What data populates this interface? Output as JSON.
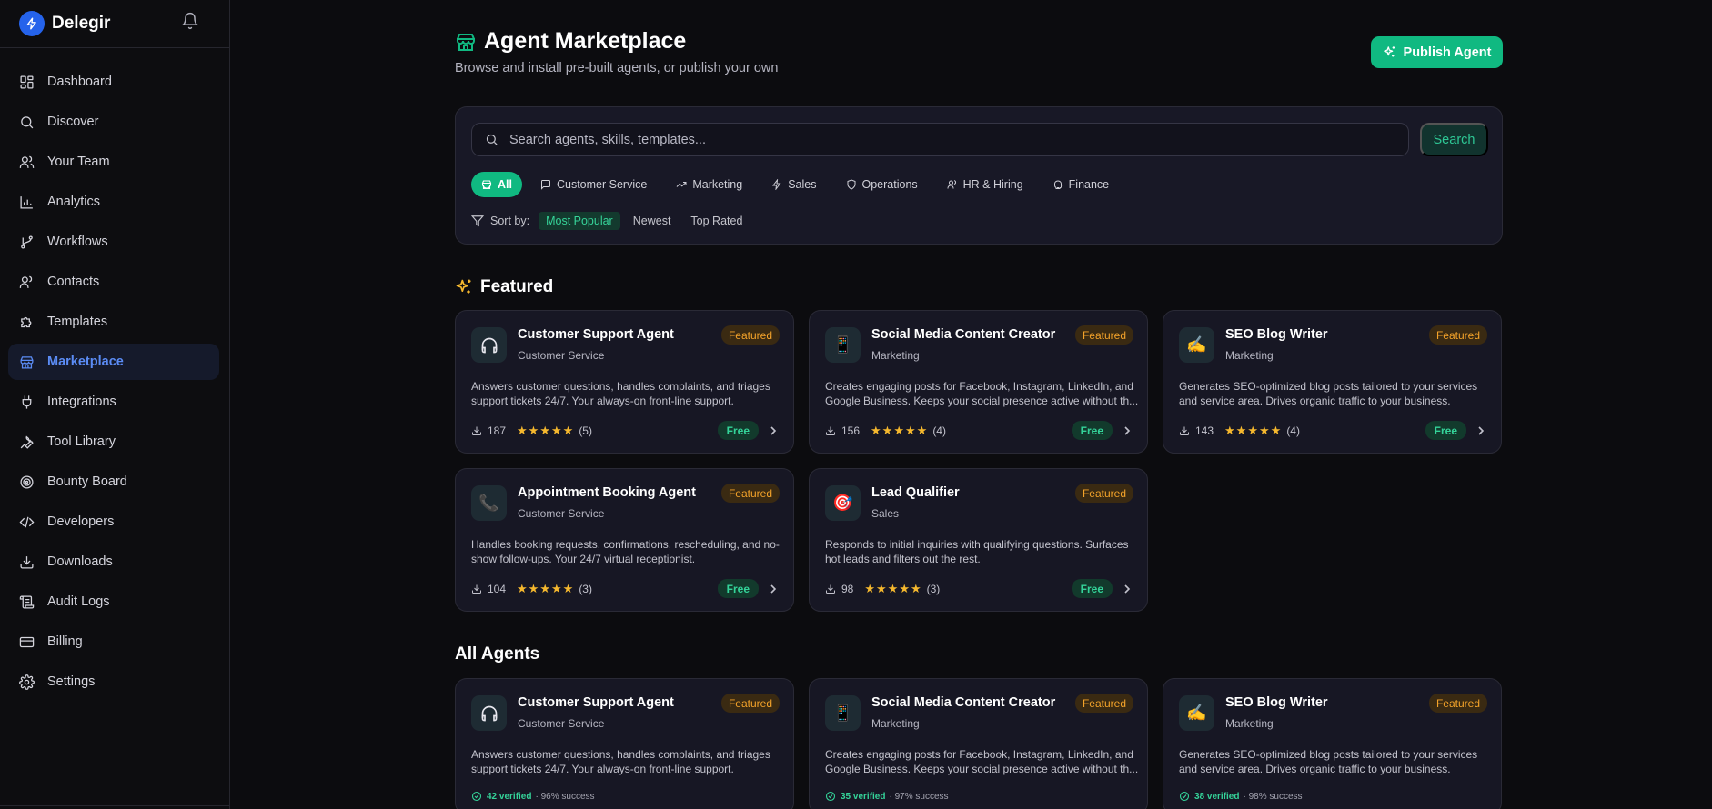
{
  "brand": {
    "name": "Delegir",
    "color": "#2563eb",
    "logo_icon": "bolt-icon"
  },
  "sidebar": {
    "items": [
      {
        "label": "Dashboard",
        "icon": "dashboard-icon"
      },
      {
        "label": "Discover",
        "icon": "search-icon"
      },
      {
        "label": "Your Team",
        "icon": "team-icon"
      },
      {
        "label": "Analytics",
        "icon": "analytics-icon"
      },
      {
        "label": "Workflows",
        "icon": "workflow-icon"
      },
      {
        "label": "Contacts",
        "icon": "contacts-icon"
      },
      {
        "label": "Templates",
        "icon": "puzzle-icon"
      },
      {
        "label": "Marketplace",
        "icon": "store-icon",
        "active": true
      },
      {
        "label": "Integrations",
        "icon": "plug-icon"
      },
      {
        "label": "Tool Library",
        "icon": "wrench-icon"
      },
      {
        "label": "Bounty Board",
        "icon": "target-icon"
      },
      {
        "label": "Developers",
        "icon": "code-icon"
      },
      {
        "label": "Downloads",
        "icon": "download-icon"
      },
      {
        "label": "Audit Logs",
        "icon": "scroll-icon"
      },
      {
        "label": "Billing",
        "icon": "card-icon"
      },
      {
        "label": "Settings",
        "icon": "gear-icon"
      }
    ]
  },
  "header": {
    "title": "Agent Marketplace",
    "subtitle": "Browse and install pre-built agents, or publish your own",
    "publish_label": "Publish Agent"
  },
  "search": {
    "placeholder": "Search agents, skills, templates...",
    "value": "",
    "button_label": "Search"
  },
  "categories": [
    {
      "label": "All",
      "active": true
    },
    {
      "label": "Customer Service"
    },
    {
      "label": "Marketing"
    },
    {
      "label": "Sales"
    },
    {
      "label": "Operations"
    },
    {
      "label": "HR & Hiring"
    },
    {
      "label": "Finance"
    }
  ],
  "sort": {
    "label": "Sort by:",
    "options": [
      "Most Popular",
      "Newest",
      "Top Rated"
    ],
    "selected": "Most Popular"
  },
  "featured": {
    "title": "Featured",
    "cards": [
      {
        "name": "Customer Support Agent",
        "category": "Customer Service",
        "badge": "Featured",
        "emoji": "🎧",
        "description": "Answers customer questions, handles complaints, and triages support tickets 24/7. Your always-on front-line support.",
        "downloads": "187",
        "stars": "★★★★★",
        "rating_count": "(5)",
        "price": "Free"
      },
      {
        "name": "Social Media Content Creator",
        "category": "Marketing",
        "badge": "Featured",
        "emoji": "📱",
        "description": "Creates engaging posts for Facebook, Instagram, LinkedIn, and Google Business. Keeps your social presence active without th...",
        "downloads": "156",
        "stars": "★★★★★",
        "rating_count": "(4)",
        "price": "Free"
      },
      {
        "name": "SEO Blog Writer",
        "category": "Marketing",
        "badge": "Featured",
        "emoji": "✍️",
        "description": "Generates SEO-optimized blog posts tailored to your services and service area. Drives organic traffic to your business.",
        "downloads": "143",
        "stars": "★★★★★",
        "rating_count": "(4)",
        "price": "Free"
      },
      {
        "name": "Appointment Booking Agent",
        "category": "Customer Service",
        "badge": "Featured",
        "emoji": "📞",
        "description": "Handles booking requests, confirmations, rescheduling, and no-show follow-ups. Your 24/7 virtual receptionist.",
        "downloads": "104",
        "stars": "★★★★★",
        "rating_count": "(3)",
        "price": "Free"
      },
      {
        "name": "Lead Qualifier",
        "category": "Sales",
        "badge": "Featured",
        "emoji": "🎯",
        "description": "Responds to initial inquiries with qualifying questions. Surfaces hot leads and filters out the rest.",
        "downloads": "98",
        "stars": "★★★★★",
        "rating_count": "(3)",
        "price": "Free"
      }
    ]
  },
  "all_agents": {
    "title": "All Agents",
    "cards": [
      {
        "name": "Customer Support Agent",
        "category": "Customer Service",
        "badge": "Featured",
        "emoji": "🎧",
        "description": "Answers customer questions, handles complaints, and triages support tickets 24/7. Your always-on front-line support.",
        "verified": "42 verified",
        "success": "· 96% success"
      },
      {
        "name": "Social Media Content Creator",
        "category": "Marketing",
        "badge": "Featured",
        "emoji": "📱",
        "description": "Creates engaging posts for Facebook, Instagram, LinkedIn, and Google Business. Keeps your social presence active without th...",
        "verified": "35 verified",
        "success": "· 97% success"
      },
      {
        "name": "SEO Blog Writer",
        "category": "Marketing",
        "badge": "Featured",
        "emoji": "✍️",
        "description": "Generates SEO-optimized blog posts tailored to your services and service area. Drives organic traffic to your business.",
        "verified": "38 verified",
        "success": "· 98% success"
      }
    ]
  },
  "colors": {
    "accent": "#10b981",
    "active_nav": "#5b8cf5",
    "badge": "#f4a32a",
    "star": "#f5b82e"
  }
}
